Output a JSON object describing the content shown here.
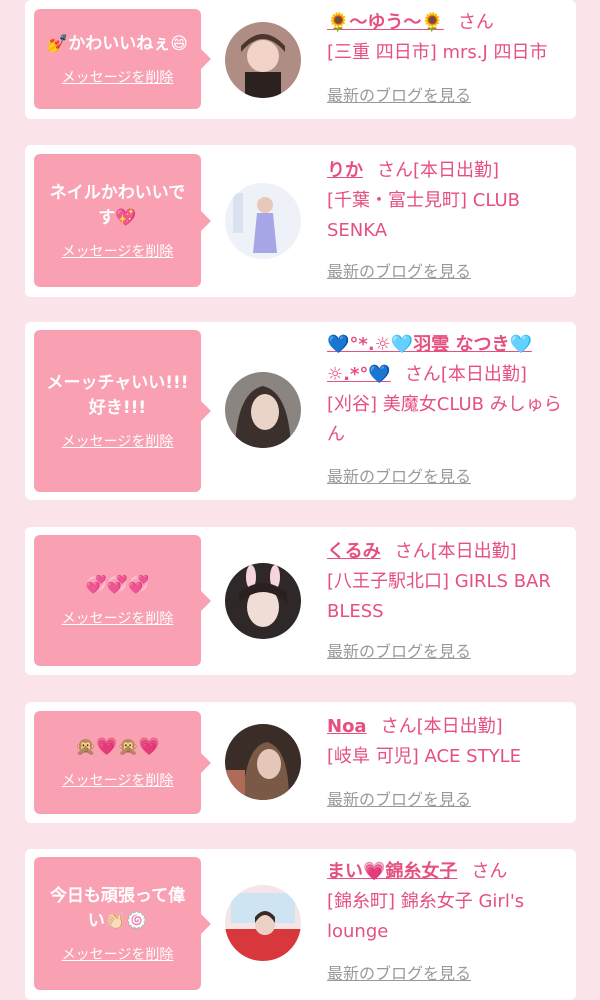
{
  "entries": [
    {
      "message": "💅かわいいねぇ😄",
      "delete_label": "メッセージを削除",
      "name": "🌻〜ゆう〜🌻",
      "honorific": "さん",
      "status": "",
      "shop": "[三重 四日市] mrs.J 四日市",
      "blog_label": "最新のブログを見る",
      "avatar_color": "#8c6f68"
    },
    {
      "message": "ネイルかわいいです💖",
      "delete_label": "メッセージを削除",
      "name": "りか",
      "honorific": "さん",
      "status": "[本日出勤]",
      "shop": "[千葉・富士見町] CLUB SENKA",
      "blog_label": "最新のブログを見る",
      "avatar_color": "#d6e1ef"
    },
    {
      "message": "メーッチャいい!!!好き!!!",
      "delete_label": "メッセージを削除",
      "name": "💙°*.☼🩵羽雲 なつき🩵☼.*°💙",
      "honorific": "さん",
      "status": "[本日出勤]",
      "shop": "[刈谷] 美魔女CLUB みしゅらん",
      "blog_label": "最新のブログを見る",
      "avatar_color": "#6f6560"
    },
    {
      "message": "💞💞💞",
      "delete_label": "メッセージを削除",
      "name": "くるみ",
      "honorific": "さん",
      "status": "[本日出勤]",
      "shop": "[八王子駅北口] GIRLS BAR BLESS",
      "blog_label": "最新のブログを見る",
      "avatar_color": "#3b3232"
    },
    {
      "message": "🙊💗🙊💗",
      "delete_label": "メッセージを削除",
      "name": "Noa",
      "honorific": "さん",
      "status": "[本日出勤]",
      "shop": "[岐阜 可児] ACE STYLE",
      "blog_label": "最新のブログを見る",
      "avatar_color": "#3a2d28"
    },
    {
      "message": "今日も頑張って偉い👏🏻🍥",
      "delete_label": "メッセージを削除",
      "name": "まい💗錦糸女子",
      "honorific": "さん",
      "status": "",
      "shop": "[錦糸町] 錦糸女子 Girl's lounge",
      "blog_label": "最新のブログを見る",
      "avatar_color": "#e8c9c4"
    }
  ]
}
